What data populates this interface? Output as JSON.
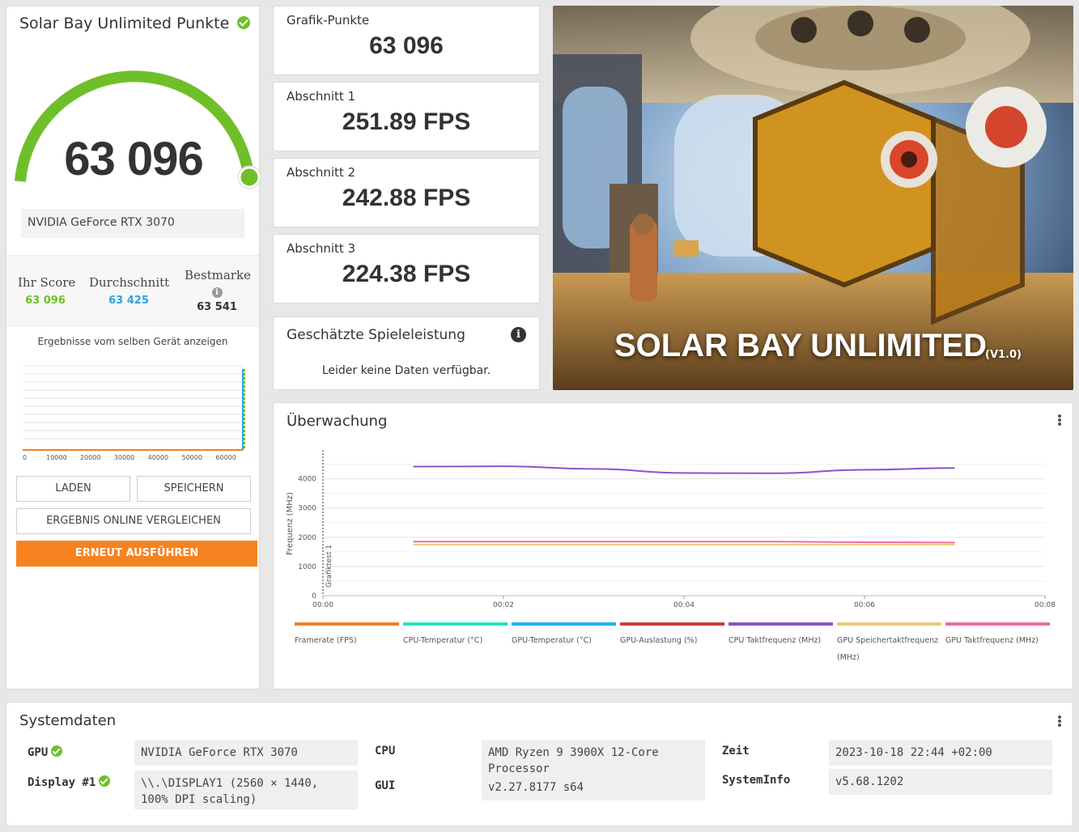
{
  "score_panel": {
    "title": "Solar Bay Unlimited Punkte",
    "score": "63 096",
    "device": "NVIDIA GeForce RTX 3070",
    "stats": {
      "your_label": "Ihr Score",
      "your_value": "63 096",
      "avg_label": "Durchschnitt",
      "avg_value": "63 425",
      "best_label": "Bestmarke",
      "best_value": "63 541"
    },
    "same_device_label": "Ergebnisse vom selben Gerät anzeigen",
    "mini_chart_ticks": [
      "0",
      "10000",
      "20000",
      "30000",
      "40000",
      "50000",
      "60000"
    ],
    "buttons": {
      "load": "LADEN",
      "save": "SPEICHERN",
      "compare": "ERGEBNIS ONLINE VERGLEICHEN",
      "rerun": "ERNEUT AUSFÜHREN"
    },
    "colors": {
      "score_green": "#6fbf2a",
      "avg_blue": "#2ea3dd",
      "run_orange": "#f68320"
    }
  },
  "stat_cards": [
    {
      "label": "Grafik-Punkte",
      "value": "63 096"
    },
    {
      "label": "Abschnitt 1",
      "value": "251.89 FPS"
    },
    {
      "label": "Abschnitt 2",
      "value": "242.88 FPS"
    },
    {
      "label": "Abschnitt 3",
      "value": "224.38 FPS"
    }
  ],
  "game_perf": {
    "title": "Geschätzte Spieleleistung",
    "message": "Leider keine Daten verfügbar."
  },
  "hero": {
    "title": "SOLAR BAY UNLIMITED",
    "version": "(V1.0)"
  },
  "monitoring": {
    "title": "Überwachung",
    "ylabel": "Frequenz (MHz)",
    "section_label": "Grafiktest 1",
    "legend": [
      {
        "label": "Framerate (FPS)",
        "color": "#f07f23"
      },
      {
        "label": "CPU-Temperatur (°C)",
        "color": "#26e3c0"
      },
      {
        "label": "GPU-Temperatur (°C)",
        "color": "#1fb3ee"
      },
      {
        "label": "GPU-Auslastung (%)",
        "color": "#c83a3a"
      },
      {
        "label": "CPU Taktfrequenz (MHz)",
        "color": "#8a52c9"
      },
      {
        "label": "GPU Speichertaktfrequenz (MHz)",
        "color": "#ecc97a"
      },
      {
        "label": "GPU Taktfrequenz (MHz)",
        "color": "#e86da8"
      }
    ]
  },
  "chart_data": {
    "type": "line",
    "title": "",
    "xlabel": "",
    "ylabel": "Frequenz (MHz)",
    "x_ticks": [
      "00:00",
      "00:02",
      "00:04",
      "00:06",
      "00:08"
    ],
    "y_ticks": [
      0,
      1000,
      2000,
      3000,
      4000
    ],
    "xlim": [
      0,
      8
    ],
    "ylim": [
      0,
      4600
    ],
    "grid": true,
    "legend_position": "bottom",
    "series": [
      {
        "name": "CPU Taktfrequenz (MHz)",
        "color": "#8a52c9",
        "x": [
          1,
          2,
          3,
          4,
          5,
          6,
          7
        ],
        "values": [
          4420,
          4430,
          4340,
          4200,
          4190,
          4310,
          4370
        ]
      },
      {
        "name": "GPU Taktfrequenz (MHz)",
        "color": "#e86da8",
        "x": [
          1,
          2,
          3,
          4,
          5,
          6,
          7
        ],
        "values": [
          1850,
          1850,
          1850,
          1850,
          1850,
          1830,
          1820
        ]
      },
      {
        "name": "GPU Speichertaktfrequenz (MHz)",
        "color": "#ecc97a",
        "x": [
          1,
          2,
          3,
          4,
          5,
          6,
          7
        ],
        "values": [
          1750,
          1750,
          1750,
          1750,
          1750,
          1750,
          1750
        ]
      }
    ]
  },
  "system": {
    "title": "Systemdaten",
    "rows": {
      "gpu_label": "GPU",
      "gpu_value": "NVIDIA GeForce RTX 3070",
      "display_label": "Display #1",
      "display_value": "\\\\.\\DISPLAY1 (2560 × 1440, 100% DPI scaling)",
      "cpu_label": "CPU",
      "cpu_value": "AMD Ryzen 9 3900X 12-Core Processor",
      "gui_label": "GUI",
      "gui_value": "v2.27.8177 s64",
      "time_label": "Zeit",
      "time_value": "2023-10-18 22:44 +02:00",
      "sysinfo_label": "SystemInfo",
      "sysinfo_value": "v5.68.1202"
    }
  }
}
